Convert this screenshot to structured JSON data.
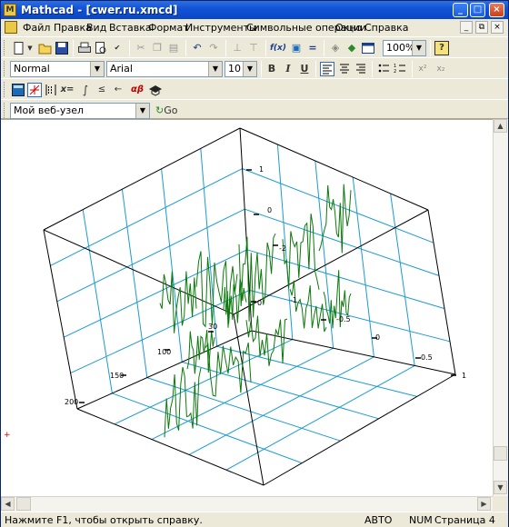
{
  "window": {
    "title": "Mathcad - [cwer.ru.xmcd]",
    "minimize": "_",
    "maximize": "□",
    "close": "×"
  },
  "menubar": {
    "items": [
      "Файл",
      "Правка",
      "Вид",
      "Вставка",
      "Формат",
      "Инструменты",
      "Символьные операции",
      "Окно",
      "Справка"
    ],
    "mdi_min": "_",
    "mdi_restore": "⧉",
    "mdi_close": "×"
  },
  "standard_toolbar": {
    "zoom": "100%",
    "icons": [
      "new-icon",
      "open-icon",
      "save-icon",
      "print-icon",
      "print-preview-icon",
      "spellcheck-icon",
      "cut-icon",
      "copy-icon",
      "paste-icon",
      "undo-icon",
      "redo-icon",
      "align-icon",
      "insert-function-icon",
      "insert-unit-icon",
      "calculate-icon",
      "insert-component-icon",
      "resources-icon",
      "help-icon"
    ],
    "fx_label": "f(x)",
    "help_label": "?"
  },
  "formatting_toolbar": {
    "style": "Normal",
    "font": "Arial",
    "size": "10",
    "bold": "B",
    "italic": "I",
    "underline": "U",
    "superscript": "x²",
    "subscript": "x₂"
  },
  "math_toolbar": {
    "icons": [
      "calculator-icon",
      "graph-icon",
      "matrix-icon",
      "evaluation-icon",
      "calculus-icon",
      "boolean-icon",
      "programming-icon",
      "greek-icon",
      "symbolic-icon"
    ],
    "eval_label": "x=",
    "greek_label": "αβ"
  },
  "web_toolbar": {
    "address": "Мой веб-узел",
    "go_label": "Go"
  },
  "plot": {
    "axis_labels": [
      "1",
      "0",
      "-1",
      "-2",
      "0",
      "-0.5",
      "0",
      "0.5",
      "1",
      "30",
      "100",
      "150",
      "200"
    ],
    "cube_color": "#000000",
    "grid_color": "#1a9ad6",
    "curve_color": "#0a7a0a"
  },
  "statusbar": {
    "help_text": "Нажмите F1, чтобы открыть справку.",
    "mode": "АВТО",
    "num": "NUM",
    "page": "Страница 4"
  }
}
